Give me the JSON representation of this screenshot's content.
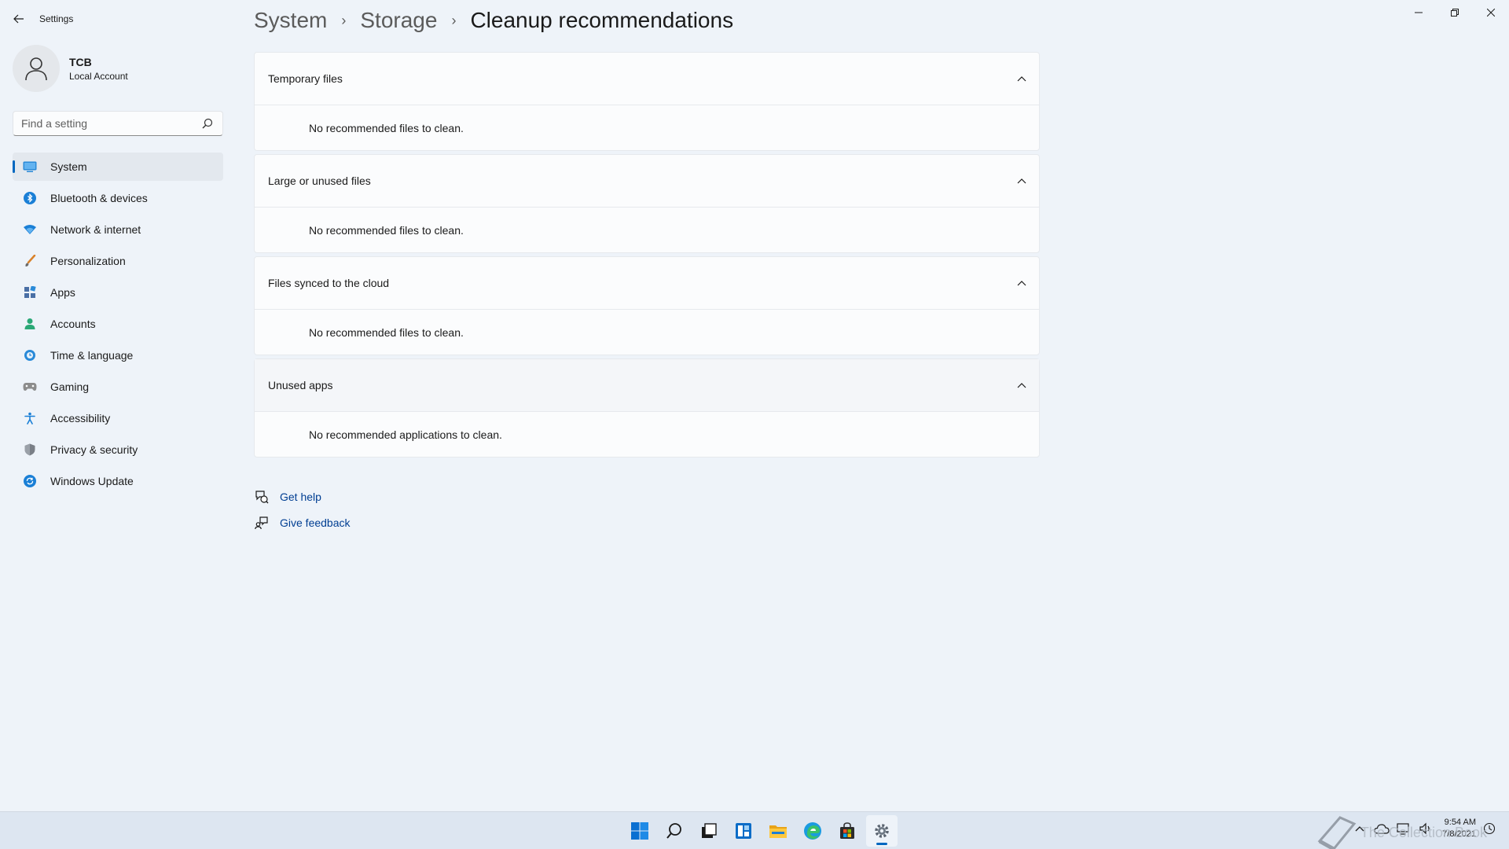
{
  "window": {
    "app_title": "Settings"
  },
  "profile": {
    "name": "TCB",
    "account_type": "Local Account"
  },
  "search": {
    "placeholder": "Find a setting"
  },
  "sidebar": {
    "items": [
      {
        "label": "System",
        "icon": "monitor-icon",
        "active": true
      },
      {
        "label": "Bluetooth & devices",
        "icon": "bluetooth-icon"
      },
      {
        "label": "Network & internet",
        "icon": "wifi-icon"
      },
      {
        "label": "Personalization",
        "icon": "brush-icon"
      },
      {
        "label": "Apps",
        "icon": "apps-icon"
      },
      {
        "label": "Accounts",
        "icon": "person-icon"
      },
      {
        "label": "Time & language",
        "icon": "globe-clock-icon"
      },
      {
        "label": "Gaming",
        "icon": "controller-icon"
      },
      {
        "label": "Accessibility",
        "icon": "accessibility-icon"
      },
      {
        "label": "Privacy & security",
        "icon": "shield-icon"
      },
      {
        "label": "Windows Update",
        "icon": "update-icon"
      }
    ]
  },
  "breadcrumb": {
    "items": [
      "System",
      "Storage"
    ],
    "current": "Cleanup recommendations"
  },
  "sections": [
    {
      "title": "Temporary files",
      "message": "No recommended files to clean."
    },
    {
      "title": "Large or unused files",
      "message": "No recommended files to clean."
    },
    {
      "title": "Files synced to the cloud",
      "message": "No recommended files to clean."
    },
    {
      "title": "Unused apps",
      "message": "No recommended applications to clean."
    }
  ],
  "help": {
    "get_help": "Get help",
    "give_feedback": "Give feedback"
  },
  "taskbar": {
    "time": "9:54 AM",
    "date": "7/8/2021"
  },
  "watermark": {
    "text": "The Collection Book"
  },
  "colors": {
    "accent": "#0067c0",
    "link": "#003e92",
    "background": "#eef3f9"
  }
}
